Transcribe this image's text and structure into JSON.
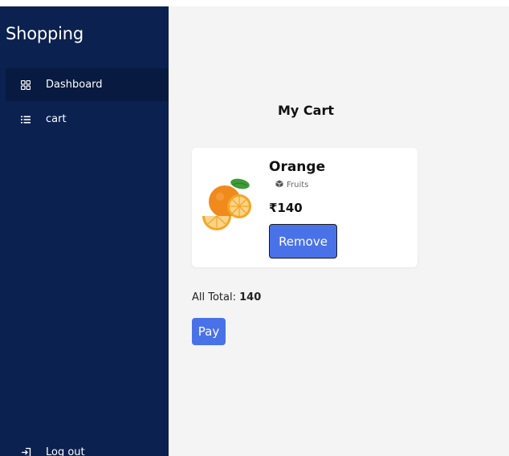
{
  "sidebar": {
    "brand": "Shopping",
    "items": [
      {
        "label": "Dashboard",
        "icon": "grid-icon",
        "active": true
      },
      {
        "label": "cart",
        "icon": "list-icon",
        "active": false
      }
    ],
    "logout_label": "Log out"
  },
  "main": {
    "title": "My Cart",
    "cart_item": {
      "name": "Orange",
      "category": "Fruits",
      "price": "₹140",
      "remove_label": "Remove"
    },
    "total_label": "All Total:",
    "total_value": "140",
    "pay_label": "Pay"
  },
  "colors": {
    "sidebar_bg": "#0b2150",
    "accent": "#4a72e8",
    "main_bg": "#f4f4f5"
  }
}
